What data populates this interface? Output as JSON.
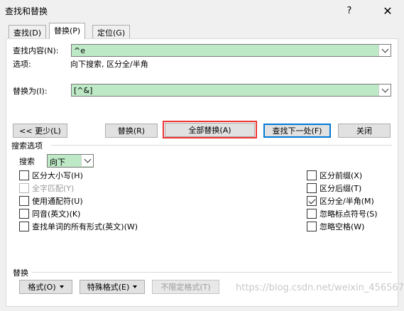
{
  "window": {
    "title": "查找和替换",
    "help_glyph": "?",
    "close_glyph": "✕"
  },
  "tabs": [
    {
      "label": "查找(D)",
      "active": false
    },
    {
      "label": "替换(P)",
      "active": true
    },
    {
      "label": "定位(G)",
      "active": false
    }
  ],
  "find": {
    "label": "查找内容(N):",
    "value": "^e",
    "options_label": "选项:",
    "options_value": "向下搜索, 区分全/半角"
  },
  "replace": {
    "label": "替换为(I):",
    "value": "[^&]"
  },
  "buttons": {
    "less": "<< 更少(L)",
    "replace": "替换(R)",
    "replace_all": "全部替换(A)",
    "find_next": "查找下一处(F)",
    "close": "关闭"
  },
  "search_options": {
    "section_label": "搜索选项",
    "search_label": "搜索",
    "direction": "向下",
    "left_checks": [
      {
        "label": "区分大小写(H)",
        "checked": false,
        "disabled": false
      },
      {
        "label": "全字匹配(Y)",
        "checked": false,
        "disabled": true
      },
      {
        "label": "使用通配符(U)",
        "checked": false,
        "disabled": false
      },
      {
        "label": "同音(英文)(K)",
        "checked": false,
        "disabled": false
      },
      {
        "label": "查找单词的所有形式(英文)(W)",
        "checked": false,
        "disabled": false
      }
    ],
    "right_checks": [
      {
        "label": "区分前缀(X)",
        "checked": false
      },
      {
        "label": "区分后缀(T)",
        "checked": false
      },
      {
        "label": "区分全/半角(M)",
        "checked": true
      },
      {
        "label": "忽略标点符号(S)",
        "checked": false
      },
      {
        "label": "忽略空格(W)",
        "checked": false
      }
    ]
  },
  "replace_section": {
    "label": "替换",
    "format_button": "格式(O)",
    "special_button": "特殊格式(E)",
    "no_format_button": "不限定格式(T)"
  },
  "watermark": "https://blog.csdn.net/weixin_45656790",
  "colors": {
    "combo_bg": "#bde9c6",
    "highlight": "#ee3333",
    "focus": "#0078d7"
  }
}
